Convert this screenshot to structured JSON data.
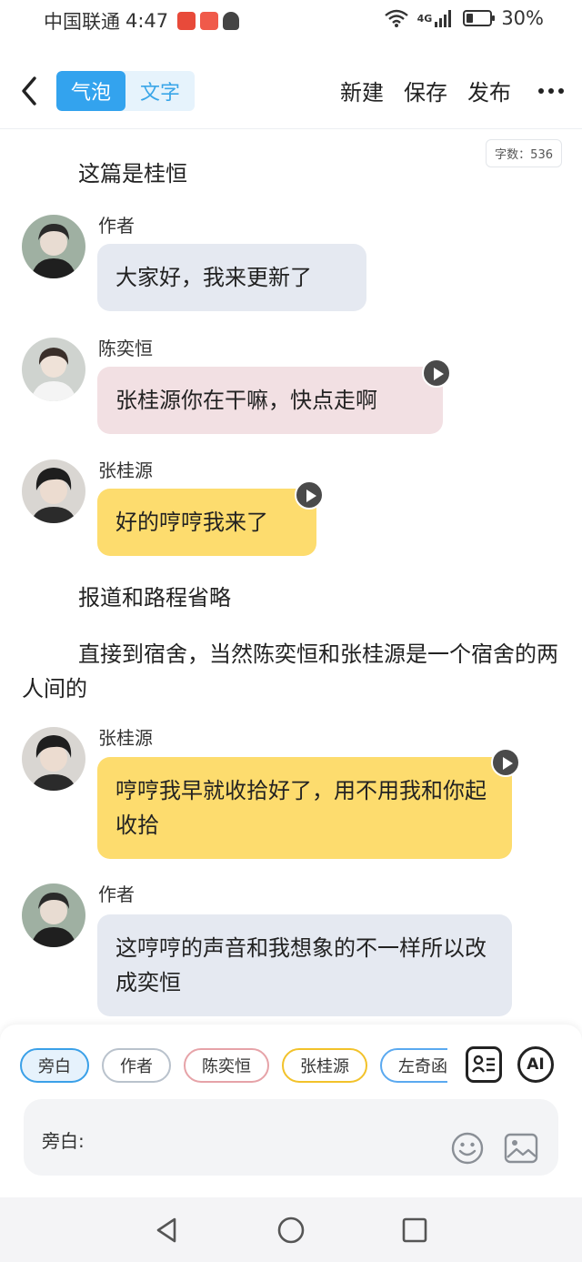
{
  "status": {
    "carrier": "中国联通",
    "time": "4:47",
    "network": "4G",
    "battery": "30%",
    "battery_level": 0.3
  },
  "header": {
    "tabs": [
      {
        "label": "气泡",
        "active": true
      },
      {
        "label": "文字",
        "active": false
      }
    ],
    "new_label": "新建",
    "save_label": "保存",
    "publish_label": "发布",
    "word_count": "字数：536"
  },
  "content": {
    "narration_1": "这篇是桂恒",
    "messages": [
      {
        "speaker": "作者",
        "text": "大家好，我来更新了",
        "style": "grey"
      },
      {
        "speaker": "陈奕恒",
        "text": "张桂源你在干嘛，快点走啊",
        "style": "pink"
      },
      {
        "speaker": "张桂源",
        "text": "好的哼哼我来了",
        "style": "yellow"
      },
      {
        "speaker": "张桂源",
        "text": "哼哼我早就收拾好了，用不用我和你起收拾",
        "style": "yellow"
      },
      {
        "speaker": "作者",
        "text": "这哼哼的声音和我想象的不一样所以改成奕恒",
        "style": "grey"
      }
    ],
    "narration_2": "报道和路程省略",
    "narration_3": "直接到宿舍，当然陈奕恒和张桂源是一个宿舍的两人间的"
  },
  "composer": {
    "chips": [
      "旁白",
      "作者",
      "陈奕恒",
      "张桂源",
      "左奇函"
    ],
    "ai_label": "AI",
    "input_label": "旁白:"
  },
  "colors": {
    "accent": "#33a3ee",
    "bubble_grey": "#e5e9f1",
    "bubble_pink": "#f2e0e3",
    "bubble_yellow": "#fddc6e"
  }
}
